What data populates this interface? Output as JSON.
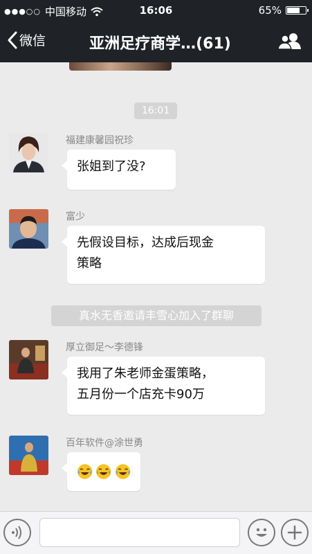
{
  "status_bar": {
    "carrier": "中国移动",
    "time": "16:06",
    "battery": "65%",
    "battery_level": 0.65
  },
  "nav": {
    "back_label": "微信",
    "title": "亚洲足疗商学…(61)",
    "back_icon": "chevron-left-icon",
    "group_icon": "group-members-icon"
  },
  "chat": {
    "time_divider": "16:01",
    "system_notice": "真水无香邀请丰雪心加入了群聊",
    "messages": [
      {
        "sender": "福建康馨园祝珍",
        "lines": [
          "张姐到了没?"
        ]
      },
      {
        "sender": "富少",
        "lines": [
          "先假设目标，达成后现金",
          "策略"
        ]
      },
      {
        "sender": "厚立御足～李德锋",
        "lines": [
          "我用了朱老师金蛋策略，",
          "五月份一个店充卡90万"
        ]
      },
      {
        "sender": "百年软件@涂世勇",
        "emoji": [
          "laughing-crying-face-icon",
          "laughing-crying-face-icon",
          "laughing-crying-face-icon"
        ]
      }
    ]
  },
  "input_bar": {
    "voice_icon": "voice-icon",
    "emoji_icon": "smiley-face-icon",
    "plus_icon": "plus-icon",
    "input_value": ""
  }
}
